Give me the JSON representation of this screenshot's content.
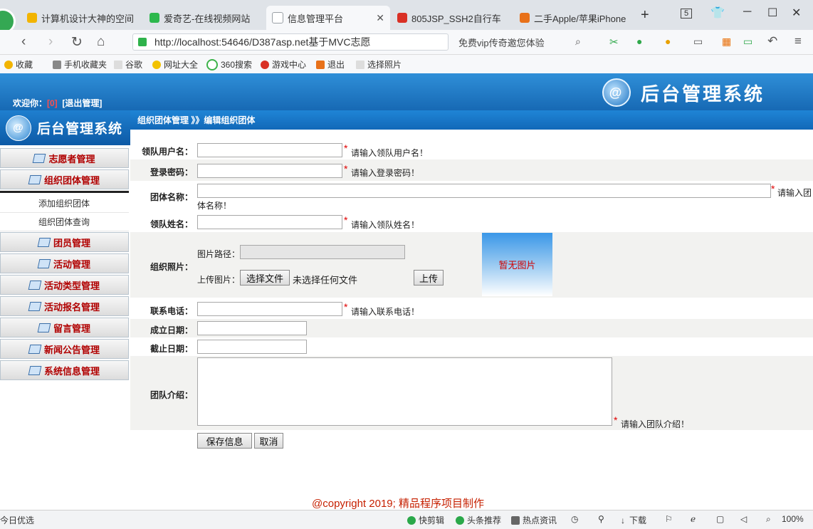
{
  "browser": {
    "tabs": [
      {
        "title": "计算机设计大神的空间",
        "color": "#f2b400"
      },
      {
        "title": "爱奇艺-在线视频网站",
        "color": "#2db84d"
      },
      {
        "title": "信息管理平台",
        "color": "#9aa0a6"
      },
      {
        "title": "805JSP_SSH2自行车",
        "color": "#d93025"
      },
      {
        "title": "二手Apple/苹果iPhone",
        "color": "#e8711a"
      }
    ],
    "new_tab": "+",
    "tab_count": "5",
    "url": "http://localhost:54646/D387asp.net基于MVC志愿",
    "search_text": "免费vip传奇邀您体验",
    "bookmarks": [
      "收藏",
      "手机收藏夹",
      "谷歌",
      "网址大全",
      "360搜索",
      "游戏中心",
      "退出",
      "选择照片"
    ]
  },
  "app": {
    "title": "后台管理系统",
    "welcome_label": "欢迎你：",
    "username": "[0]",
    "logout": "[退出管理]"
  },
  "sidebar": {
    "title": "后台管理系统",
    "menu": [
      {
        "label": "志愿者管理"
      },
      {
        "label": "组织团体管理"
      },
      {
        "label": "团员管理"
      },
      {
        "label": "活动管理"
      },
      {
        "label": "活动类型管理"
      },
      {
        "label": "活动报名管理"
      },
      {
        "label": "留言管理"
      },
      {
        "label": "新闻公告管理"
      },
      {
        "label": "系统信息管理"
      }
    ],
    "submenu": [
      "添加组织团体",
      "组织团体查询"
    ]
  },
  "breadcrumb": "组织团体管理 》》编辑组织团体",
  "form": {
    "username": {
      "label": "领队用户名：",
      "value": "",
      "hint": "请输入领队用户名！"
    },
    "password": {
      "label": "登录密码：",
      "value": "",
      "hint": "请输入登录密码！"
    },
    "teamname": {
      "label": "团体名称：",
      "value": "",
      "hint_line1": "请输入团",
      "hint_line2": "体名称！"
    },
    "leader": {
      "label": "领队姓名：",
      "value": "",
      "hint": "请输入领队姓名！"
    },
    "photo": {
      "label": "组织照片：",
      "path_label": "图片路径：",
      "upload_label": "上传图片：",
      "choose_btn": "选择文件",
      "no_file": "未选择任何文件",
      "upload_btn": "上传",
      "no_image": "暂无图片"
    },
    "phone": {
      "label": "联系电话：",
      "value": "",
      "hint": "请输入联系电话！"
    },
    "found_date": {
      "label": "成立日期：",
      "value": ""
    },
    "end_date": {
      "label": "截止日期：",
      "value": ""
    },
    "intro": {
      "label": "团队介绍：",
      "value": "",
      "hint": "请输入团队介绍！"
    },
    "save_btn": "保存信息",
    "cancel_btn": "取消"
  },
  "footer": "@copyright 2019; 精品程序项目制作",
  "statusbar": {
    "left": "今日优选",
    "items": [
      "快剪辑",
      "头条推荐",
      "热点资讯",
      "下载"
    ],
    "zoom": "100%"
  }
}
